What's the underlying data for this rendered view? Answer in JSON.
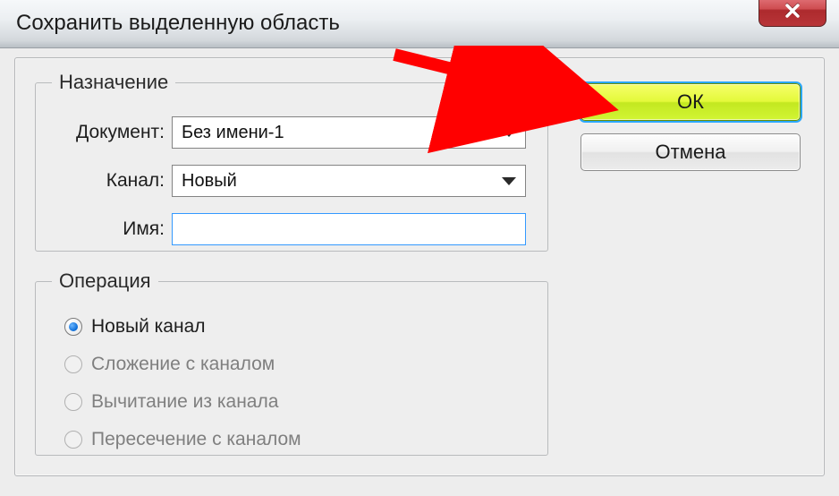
{
  "title": "Сохранить выделенную область",
  "buttons": {
    "ok": "ОК",
    "cancel": "Отмена"
  },
  "destination": {
    "legend": "Назначение",
    "document_label": "Документ:",
    "document_value": "Без имени-1",
    "channel_label": "Канал:",
    "channel_value": "Новый",
    "name_label": "Имя:",
    "name_value": ""
  },
  "operation": {
    "legend": "Операция",
    "options": [
      {
        "label": "Новый канал",
        "selected": true,
        "enabled": true
      },
      {
        "label": "Сложение с каналом",
        "selected": false,
        "enabled": false
      },
      {
        "label": "Вычитание из канала",
        "selected": false,
        "enabled": false
      },
      {
        "label": "Пересечение с каналом",
        "selected": false,
        "enabled": false
      }
    ]
  }
}
